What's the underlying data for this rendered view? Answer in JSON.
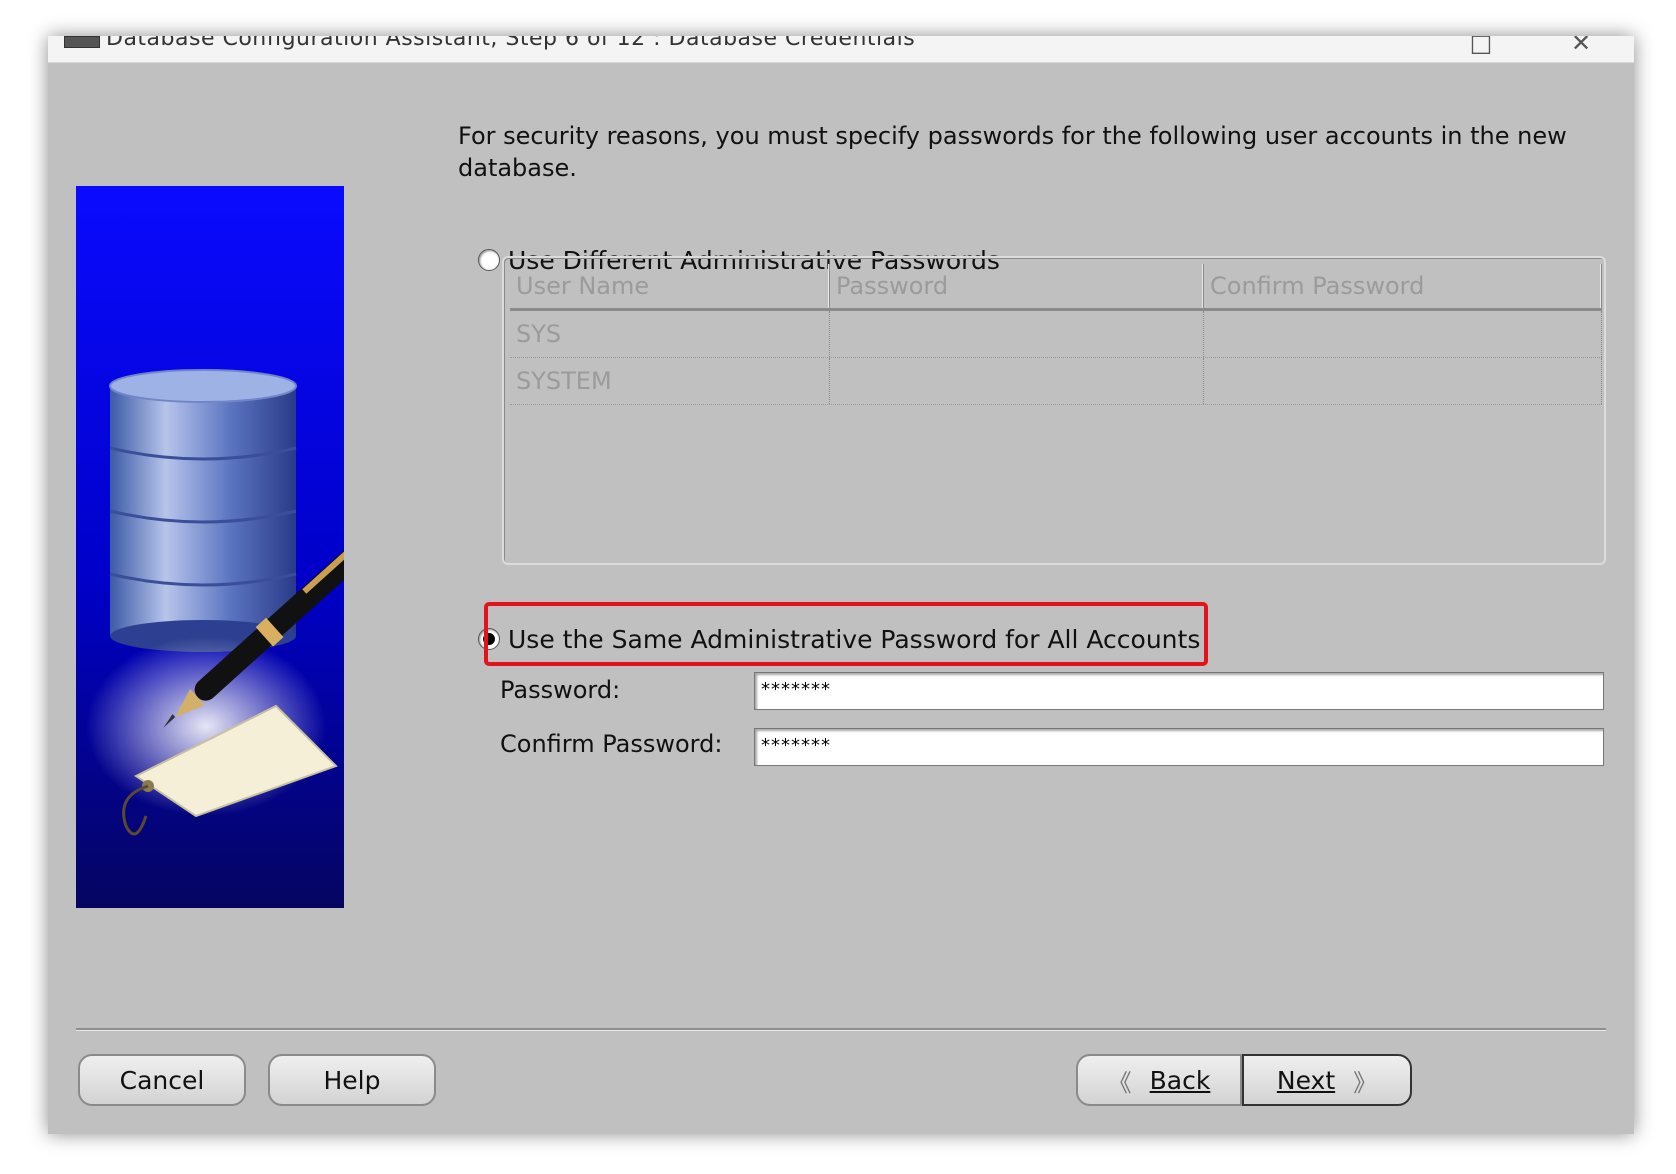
{
  "window": {
    "title": "Database Configuration Assistant, Step 6 of 12 : Database Credentials"
  },
  "intro": {
    "text": "For security reasons, you must specify passwords for the following user accounts in the new database."
  },
  "option_different": {
    "label": "Use Different Administrative Passwords",
    "selected": false
  },
  "table": {
    "columns": [
      "User Name",
      "Password",
      "Confirm Password"
    ],
    "rows": [
      [
        "SYS",
        "",
        ""
      ],
      [
        "SYSTEM",
        "",
        ""
      ]
    ]
  },
  "option_same": {
    "label": "Use the Same Administrative Password for All Accounts",
    "selected": true,
    "highlight_color": "#e3131c"
  },
  "fields": {
    "password_label": "Password:",
    "password_value": "*******",
    "confirm_label": "Confirm Password:",
    "confirm_value": "*******"
  },
  "buttons": {
    "cancel": "Cancel",
    "help": "Help",
    "back": "Back",
    "next": "Next"
  },
  "colors": {
    "dialog_bg": "#c0c0c0",
    "illustration_blue": "#0000ff"
  }
}
